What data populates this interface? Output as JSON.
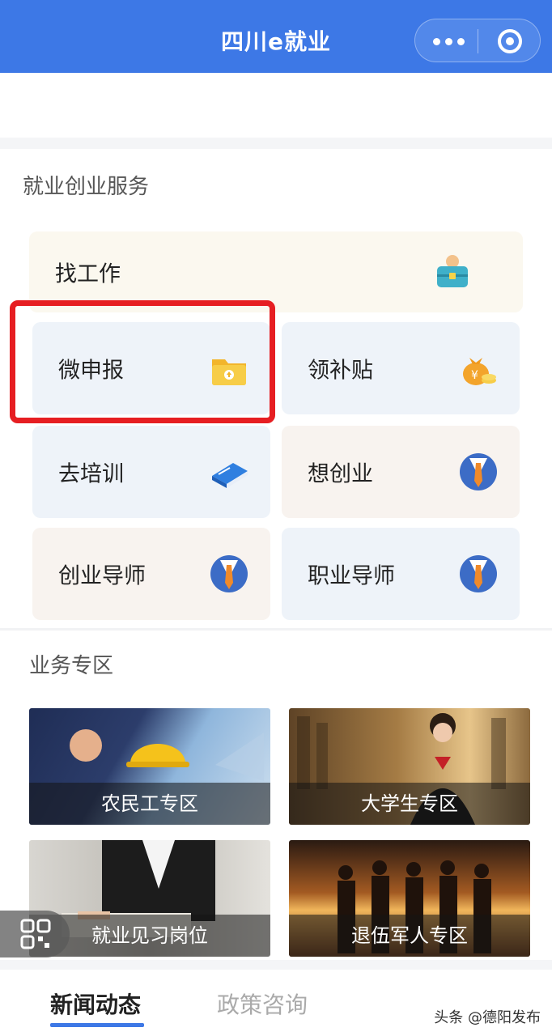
{
  "header": {
    "title": "四川e就业",
    "more_icon": "more-dots-icon",
    "close_icon": "target-circle-icon",
    "color": "#3d78e6"
  },
  "services": {
    "title": "就业创业服务",
    "items": [
      {
        "label": "找工作",
        "icon": "briefcase-icon"
      },
      {
        "label": "微申报",
        "icon": "folder-upload-icon"
      },
      {
        "label": "领补贴",
        "icon": "money-bag-icon"
      },
      {
        "label": "去培训",
        "icon": "book-icon"
      },
      {
        "label": "想创业",
        "icon": "person-tie-icon"
      },
      {
        "label": "创业导师",
        "icon": "person-tie-icon"
      },
      {
        "label": "职业导师",
        "icon": "person-tie-icon"
      }
    ],
    "highlight_color": "#e61e22"
  },
  "zones": {
    "title": "业务专区",
    "items": [
      {
        "label": "农民工专区"
      },
      {
        "label": "大学生专区"
      },
      {
        "label": "就业见习岗位"
      },
      {
        "label": "退伍军人专区"
      }
    ]
  },
  "tabs": [
    {
      "label": "新闻动态",
      "active": true
    },
    {
      "label": "政策咨询",
      "active": false
    }
  ],
  "watermark": "头条 @德阳发布"
}
